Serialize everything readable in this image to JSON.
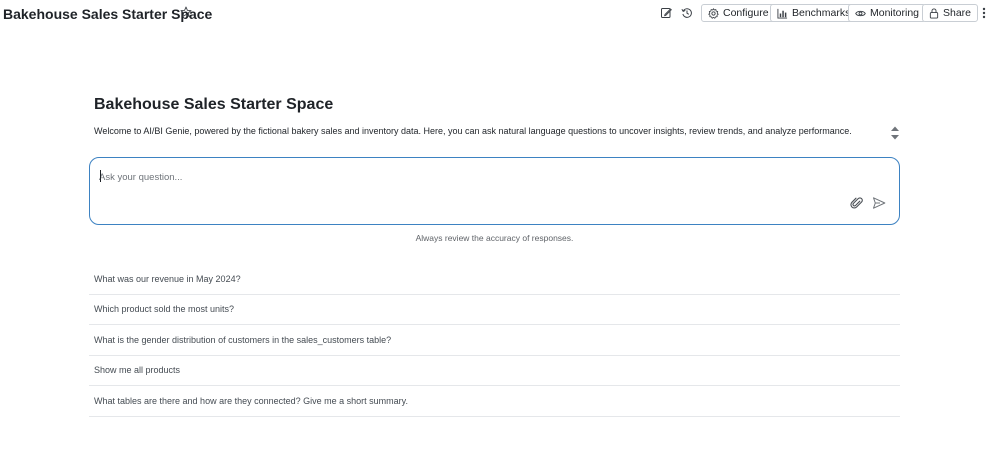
{
  "header": {
    "title": "Bakehouse Sales Starter Space",
    "buttons": {
      "configure": "Configure",
      "benchmarks": "Benchmarks",
      "monitoring": "Monitoring",
      "share": "Share"
    },
    "icons": [
      "star-icon",
      "edit-icon",
      "history-icon",
      "gear-icon",
      "bar-chart-icon",
      "eye-icon",
      "lock-icon",
      "kebab-menu-icon"
    ]
  },
  "main": {
    "title": "Bakehouse Sales Starter Space",
    "description": "Welcome to AI/BI Genie, powered by the fictional bakery sales and inventory data. Here, you can ask natural language questions to uncover insights, review trends, and analyze performance.",
    "ask": {
      "placeholder": "Ask your question...",
      "value": ""
    },
    "disclaimer": "Always review the accuracy of responses.",
    "suggestions": [
      "What was our revenue in May 2024?",
      "Which product sold the most units?",
      "What is the gender distribution of customers in the sales_customers table?",
      "Show me all products",
      "What tables are there and how are they connected? Give me a short summary."
    ]
  },
  "colors": {
    "accent_border": "#3d82c2",
    "text": "#1f2328",
    "muted_text": "#5f6368"
  }
}
